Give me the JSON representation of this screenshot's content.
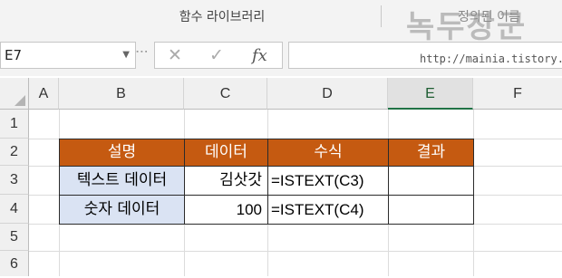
{
  "ribbon": {
    "group_label": "함수 라이브러리",
    "group_label_right": "정의된 이름"
  },
  "formula_bar": {
    "name_box": "E7",
    "cancel_icon": "✕",
    "enter_icon": "✓",
    "fx_icon": "fx",
    "formula": ""
  },
  "columns": [
    "A",
    "B",
    "C",
    "D",
    "E",
    "F"
  ],
  "selected_column": "E",
  "rows": [
    "1",
    "2",
    "3",
    "4",
    "5",
    "6"
  ],
  "table": {
    "headers": [
      "설명",
      "데이터",
      "수식",
      "결과"
    ],
    "rows": [
      {
        "label": "텍스트 데이터",
        "data": "김삿갓",
        "formula": "=ISTEXT(C3)",
        "result": ""
      },
      {
        "label": "숫자 데이터",
        "data": "100",
        "formula": "=ISTEXT(C4)",
        "result": ""
      }
    ]
  },
  "colors": {
    "header_fill": "#c55a11",
    "label_fill": "#dae3f3",
    "excel_green": "#217346"
  },
  "watermark": {
    "title": "녹두장군",
    "url": "http://mainia.tistory.com"
  }
}
